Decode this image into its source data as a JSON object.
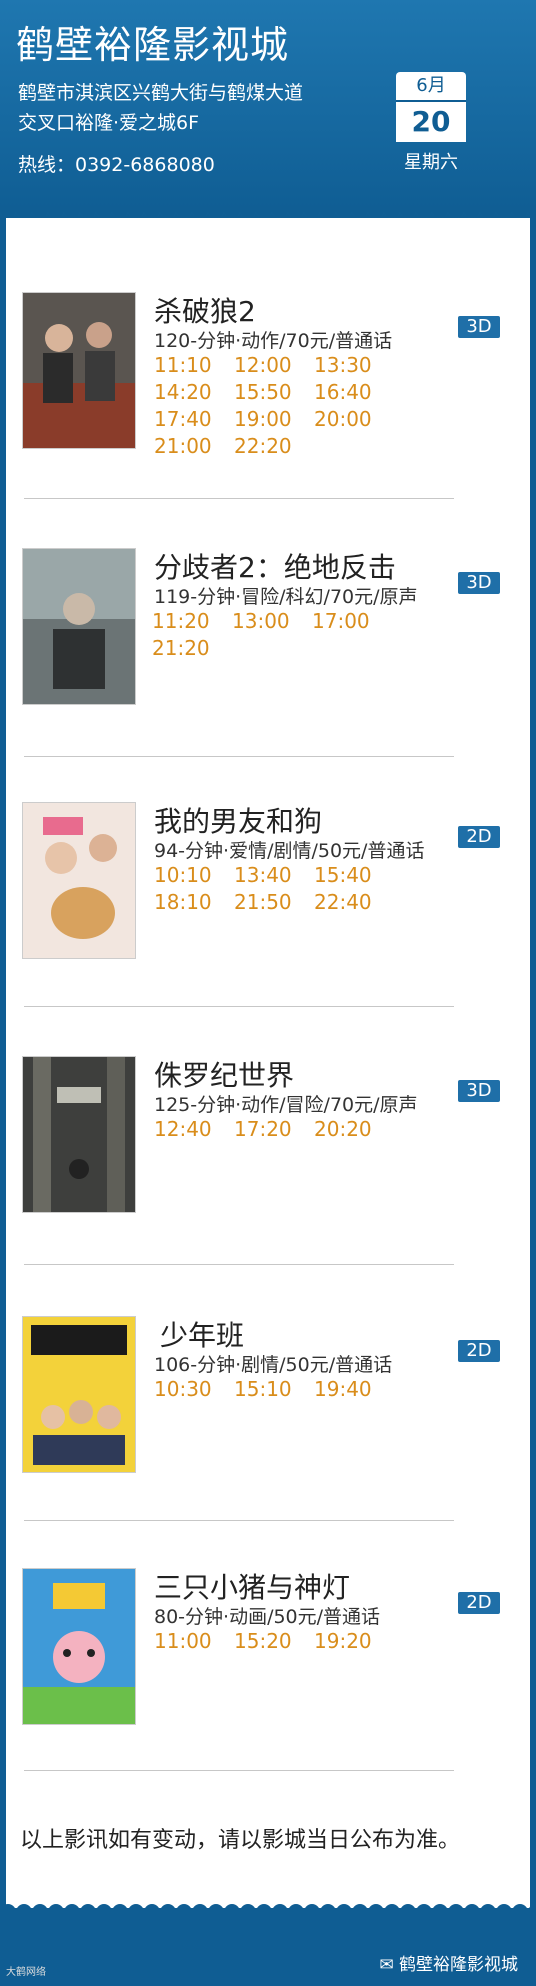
{
  "header": {
    "title": "鹤壁裕隆影视城",
    "address_line1": "鹤壁市淇滨区兴鹤大街与鹤煤大道",
    "address_line2": "交叉口裕隆·爱之城6F",
    "hotline": "热线：0392-6868080",
    "month": "6月",
    "day": "20",
    "weekday": "星期六"
  },
  "movies": [
    {
      "title": "杀破狼2",
      "info": "120-分钟·动作/70元/普通话",
      "format": "3D",
      "times": [
        "11:10",
        "12:00",
        "13:30",
        "14:20",
        "15:50",
        "16:40",
        "17:40",
        "19:00",
        "20:00",
        "21:00",
        "22:20"
      ]
    },
    {
      "title": "分歧者2：绝地反击",
      "info": "119-分钟·冒险/科幻/70元/原声",
      "format": "3D",
      "times": [
        "11:20",
        "13:00",
        "17:00",
        "21:20"
      ]
    },
    {
      "title": "我的男友和狗",
      "info": "94-分钟·爱情/剧情/50元/普通话",
      "format": "2D",
      "times": [
        "10:10",
        "13:40",
        "15:40",
        "18:10",
        "21:50",
        "22:40"
      ]
    },
    {
      "title": "侏罗纪世界",
      "info": "125-分钟·动作/冒险/70元/原声",
      "format": "3D",
      "times": [
        "12:40",
        "17:20",
        "20:20"
      ]
    },
    {
      "title": "少年班",
      "info": "106-分钟·剧情/50元/普通话",
      "format": "2D",
      "times": [
        "10:30",
        "15:10",
        "19:40"
      ]
    },
    {
      "title": "三只小猪与神灯",
      "info": "80-分钟·动画/50元/普通话",
      "format": "2D",
      "times": [
        "11:00",
        "15:20",
        "19:20"
      ]
    }
  ],
  "notice": "以上影讯如有变动，请以影城当日公布为准。",
  "watermark_left": "大鹤网络",
  "watermark_right": "鹤壁裕隆影视城",
  "colors": {
    "header_blue": "#0f5d93",
    "time_orange": "#d98d1b",
    "badge_blue": "#1f6fa8"
  }
}
